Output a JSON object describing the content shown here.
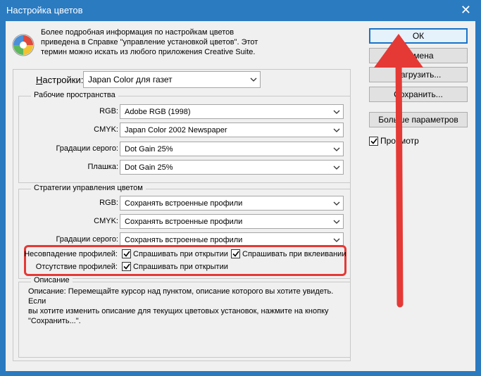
{
  "window": {
    "title": "Настройка цветов"
  },
  "info": {
    "lines": [
      "Более подробная информация по настройкам цветов",
      "приведена в Справке \"управление установкой цветов\". Этот",
      "термин можно искать из любого приложения Creative Suite."
    ]
  },
  "settings": {
    "label_underlined": "Н",
    "label_rest": "астройки:",
    "value": "Japan Color для газет"
  },
  "workspaces": {
    "title": "Рабочие пространства",
    "rows": [
      {
        "label": "RGB:",
        "value": "Adobe RGB (1998)"
      },
      {
        "label": "CMYK:",
        "value": "Japan Color 2002 Newspaper"
      },
      {
        "label": "Градации серого:",
        "value": "Dot Gain 25%"
      },
      {
        "label": "Плашка:",
        "value": "Dot Gain 25%"
      }
    ]
  },
  "policies": {
    "title": "Стратегии управления цветом",
    "rows": [
      {
        "label": "RGB:",
        "value": "Сохранять встроенные профили"
      },
      {
        "label": "CMYK:",
        "value": "Сохранять встроенные профили"
      },
      {
        "label": "Градации серого:",
        "value": "Сохранять встроенные профили"
      }
    ],
    "mismatch_label": "Несовпадение профилей:",
    "missing_label": "Отсутствие профилей:",
    "ask_on_open": "Спрашивать при открытии",
    "ask_on_paste": "Спрашивать при вклеивании",
    "ask_on_open_missing": "Спрашивать при открытии"
  },
  "description": {
    "title": "Описание",
    "lines": [
      "Описание:  Перемещайте курсор над пунктом, описание которого вы хотите увидеть.  Если",
      "вы хотите изменить описание для текущих цветовых установок, нажмите на кнопку",
      "\"Сохранить...\"."
    ]
  },
  "buttons": {
    "ok": "ОК",
    "cancel": "Отмена",
    "load": "Загрузить...",
    "save": "Сохранить...",
    "more": "Больше параметров"
  },
  "preview": {
    "label": "Просмотр",
    "checked": true
  },
  "colors": {
    "accent": "#1a73c7",
    "highlight": "#e53935",
    "titlebar": "#2b7bc1"
  }
}
